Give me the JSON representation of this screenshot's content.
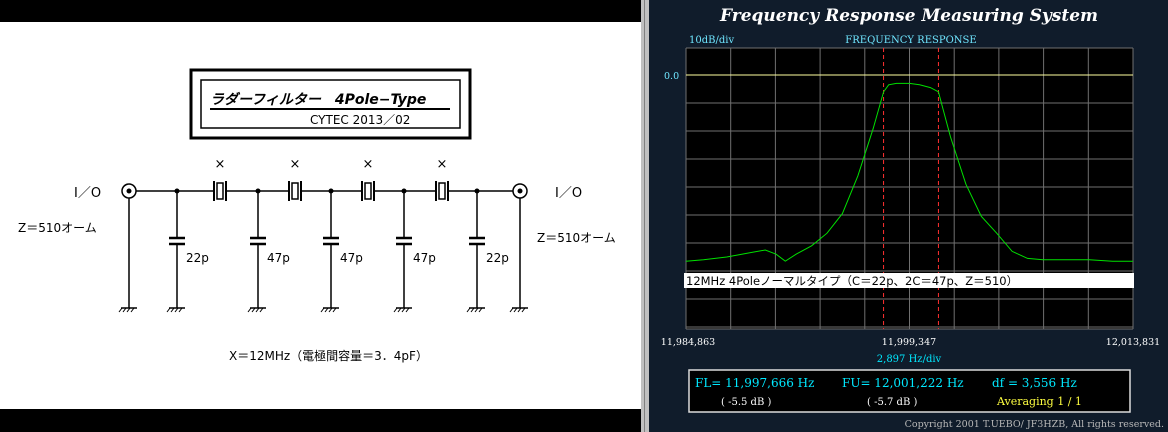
{
  "schematic": {
    "title": "ラダーフィルター　4Pole−Type",
    "subtitle": "CYTEC  2013／02",
    "io_left": "I／O",
    "io_right": "I／O",
    "impedance_left": "Z＝510オーム",
    "impedance_right": "Z＝510オーム",
    "crystal_mark": "×",
    "capacitors": [
      "22p",
      "47p",
      "47p",
      "47p",
      "22p"
    ],
    "footnote": "X＝12MHz（電極間容量＝3．4pF）"
  },
  "analyzer": {
    "title": "Frequency Response Measuring System",
    "scale_label": "10dB/div",
    "graph_title": "FREQUENCY RESPONSE",
    "ref_level": "0.0",
    "trace_label": "12MHz  4Poleノーマルタイプ（C＝22p、2C＝47p、Z＝510）",
    "freq_start": "11,984,863",
    "freq_center": "11,999,347",
    "freq_stop": "12,013,831",
    "freq_div": "2,897  Hz/div",
    "fl_label": "FL= 11,997,666  Hz",
    "fu_label": "FU= 12,001,222  Hz",
    "df_label": "df = 3,556  Hz",
    "fl_db": "( -5.5 dB )",
    "fu_db": "( -5.7 dB )",
    "averaging": "Averaging   1 / 1",
    "copyright": "Copyright 2001 T.UEBO/ JF3HZB, All rights reserved.",
    "colors": {
      "background": "#101c2b",
      "plot": "#000000",
      "grid": "#808080",
      "trace": "#00e000",
      "cursor": "#ff3030",
      "ref_line": "#ffffa0",
      "title": "#ffffff",
      "cyan": "#00e8ff",
      "yellow": "#ffff40"
    },
    "chart_data": {
      "type": "line",
      "xlabel": "",
      "ylabel": "",
      "x_unit": "Hz",
      "y_unit": "dB",
      "xlim": [
        11984863,
        12013831
      ],
      "ylim": [
        -100,
        0
      ],
      "grid": true,
      "series": [
        {
          "x": [
            11984863,
            11986000,
            11987500,
            11989000,
            11990000,
            11990700,
            11991300,
            11992000,
            11993000,
            11994000,
            11995000,
            11996000,
            11997000,
            11997666,
            11998000,
            11998500,
            11999347,
            12000000,
            12000700,
            12001222,
            12002000,
            12003000,
            12004000,
            12005000,
            12006000,
            12007000,
            12008000,
            12009500,
            12011000,
            12012500,
            12013831
          ],
          "y": [
            -66.5,
            -66,
            -65,
            -63.5,
            -62.5,
            -64,
            -66.5,
            -64,
            -61,
            -56.5,
            -49.5,
            -36,
            -19,
            -6,
            -3.5,
            -3,
            -3,
            -3.5,
            -4.5,
            -6,
            -22,
            -39,
            -50.5,
            -56.5,
            -63,
            -65.5,
            -66,
            -66,
            -66,
            -66.5,
            -66.5
          ]
        }
      ],
      "cursors_hz": [
        11997666,
        12001222
      ],
      "reference_db": 0
    }
  }
}
